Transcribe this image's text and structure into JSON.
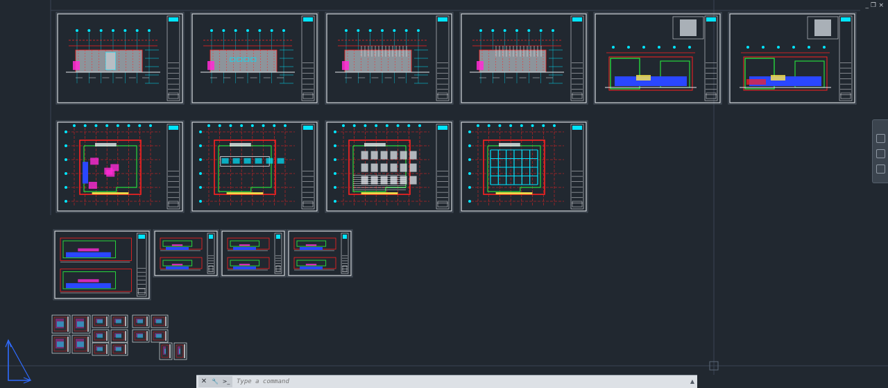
{
  "window": {
    "restore_glyph": "❐",
    "close_glyph": "×",
    "minimize_glyph": "_"
  },
  "colors": {
    "background": "#212830",
    "sheet_border": "#d8dde2",
    "red": "#ff2020",
    "cyan": "#00e5ff",
    "green": "#27d93c",
    "yellow": "#ffe94a",
    "magenta": "#ff2bd6",
    "blue": "#2a47ff",
    "white": "#e6e9ec",
    "gray": "#8a9097",
    "crosshair": "#3a4553"
  },
  "icons": {
    "ucs": "ucs-icon",
    "cmd_close": "close-icon",
    "cmd_customize": "wrench-icon",
    "cmd_prompt": "command-prompt-icon",
    "panel": "side-panel-icon"
  },
  "sheets": {
    "elevations": 4,
    "elevation_sections": 2,
    "floor_plans": 4,
    "small_sections": 4,
    "detail_groups": 5
  },
  "command_line": {
    "placeholder": "Type a command",
    "close_glyph": "✕",
    "customize_glyph": "🔧",
    "prompt_glyph": ">_",
    "history_glyph": "▲"
  }
}
